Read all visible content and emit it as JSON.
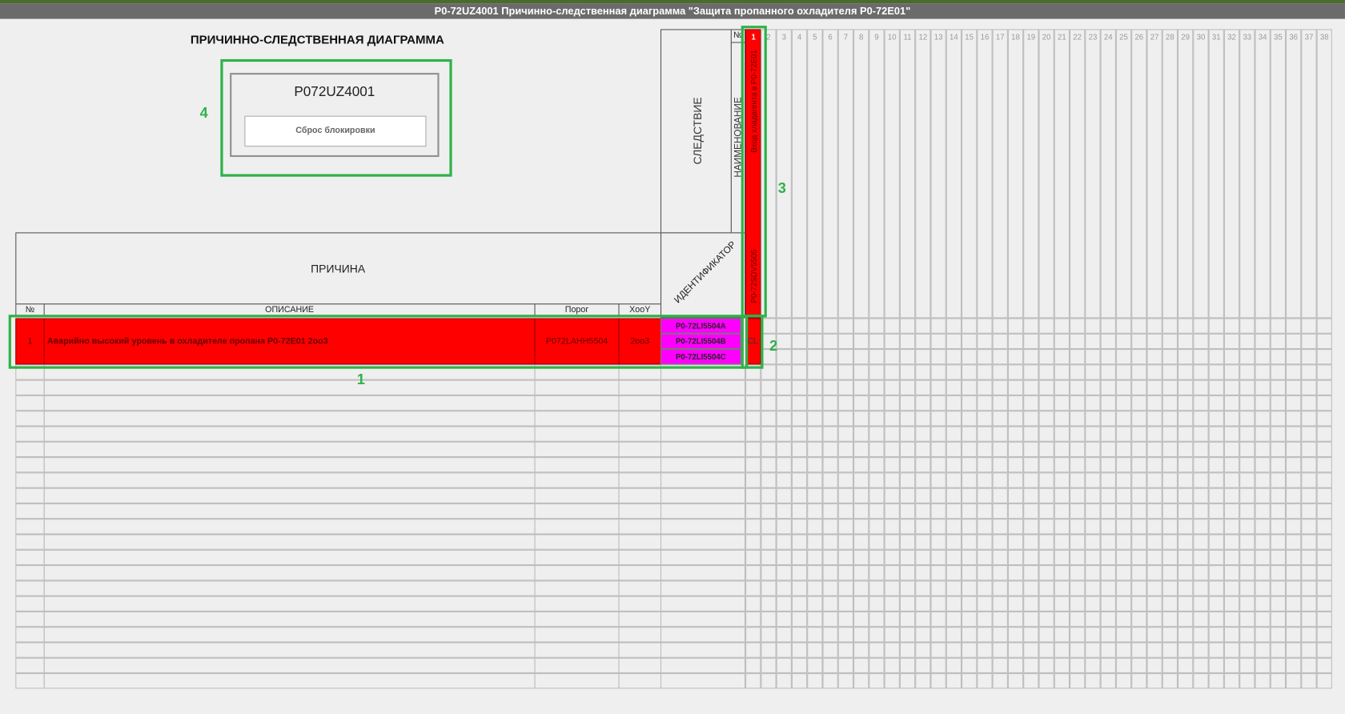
{
  "window": {
    "title": "P0-72UZ4001 Причинно-следственная диаграмма \"Защита пропанного охладителя P0-72E01\""
  },
  "diagram": {
    "heading": "ПРИЧИННО-СЛЕДСТВЕННАЯ ДИАГРАММА"
  },
  "control_panel": {
    "tag": "P072UZ4001",
    "reset_label": "Сброс блокировки"
  },
  "effect_header": {
    "label": "СЛЕДСТВИЕ",
    "name_label": "НАИМЕНОВАНИЕ",
    "number_label": "№",
    "identifier_label": "ИДЕНТИФИКАТОР"
  },
  "cause_header": {
    "label": "ПРИЧИНА",
    "col_num": "№",
    "col_desc": "ОПИСАНИЕ",
    "col_threshold": "Порог",
    "col_xooy": "XooY"
  },
  "effect_columns": [
    "1",
    "2",
    "3",
    "4",
    "5",
    "6",
    "7",
    "8",
    "9",
    "10",
    "11",
    "12",
    "13",
    "14",
    "15",
    "16",
    "17",
    "18",
    "19",
    "20",
    "21",
    "22",
    "23",
    "24",
    "25",
    "26",
    "27",
    "28",
    "29",
    "30",
    "31",
    "32",
    "33",
    "34",
    "35",
    "36",
    "37",
    "38"
  ],
  "effects": [
    {
      "number": "1",
      "name": "Вход хладагента в Р0-72Е01",
      "tag": "P0-72SDV5505"
    }
  ],
  "causes": [
    {
      "number": "1",
      "description": "Аварийно высокий уровень в охладителе пропана P0-72E01 2oo3",
      "threshold": "P072LAHH5504",
      "xooy": "2oo3",
      "identifiers": [
        "P0-72LI5504A",
        "P0-72LI5504B",
        "P0-72LI5504C"
      ],
      "link": "CL"
    }
  ],
  "annotations": [
    "1",
    "2",
    "3",
    "4"
  ],
  "colors": {
    "alarm": "#ff0000",
    "identifier": "#ff00ff",
    "highlight": "#2fb24a",
    "titlebar": "#6b6b6b"
  }
}
